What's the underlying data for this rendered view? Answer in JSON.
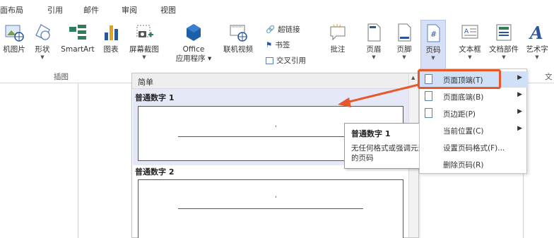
{
  "tabs": [
    "面布局",
    "引用",
    "邮件",
    "审阅",
    "视图"
  ],
  "ribbon": {
    "buttons": {
      "online_picture": "机图片",
      "shapes": "形状",
      "smartart": "SmartArt",
      "chart": "图表",
      "screenshot": "屏幕截图",
      "office_apps_line1": "Office",
      "office_apps_line2": "应用程序",
      "online_video": "联机视频",
      "comment": "批注",
      "header": "页眉",
      "footer": "页脚",
      "page_number": "页码",
      "textbox": "文本框",
      "quick_parts": "文档部件",
      "wordart": "艺术字",
      "text_group_cut": "文"
    },
    "links_group": {
      "hyperlink": "超链接",
      "bookmark": "书签",
      "cross_reference": "交叉引用"
    },
    "group_labels": {
      "illustrations": "插图"
    }
  },
  "gallery": {
    "section_header": "简单",
    "items": [
      {
        "label": "普通数字 1",
        "dot": "'"
      },
      {
        "label": "普通数字 2",
        "dot": "'"
      }
    ]
  },
  "tooltip": {
    "title": "普通数字 1",
    "body": "无任何格式或强调元素的页码"
  },
  "menu": {
    "items": [
      {
        "label": "页面顶端(T)",
        "has_submenu": true
      },
      {
        "label": "页面底端(B)",
        "has_submenu": true
      },
      {
        "label": "页边距(P)",
        "has_submenu": true
      },
      {
        "label": "当前位置(C)",
        "has_submenu": true
      },
      {
        "label": "设置页码格式(F)..."
      },
      {
        "label": "删除页码(R)"
      }
    ],
    "submenu_arrow": "▶"
  },
  "colors": {
    "highlight_box": "#e8582a",
    "arrow": "#e8582a",
    "selection": "#e4e8f7",
    "accent_blue": "#2b579a"
  }
}
